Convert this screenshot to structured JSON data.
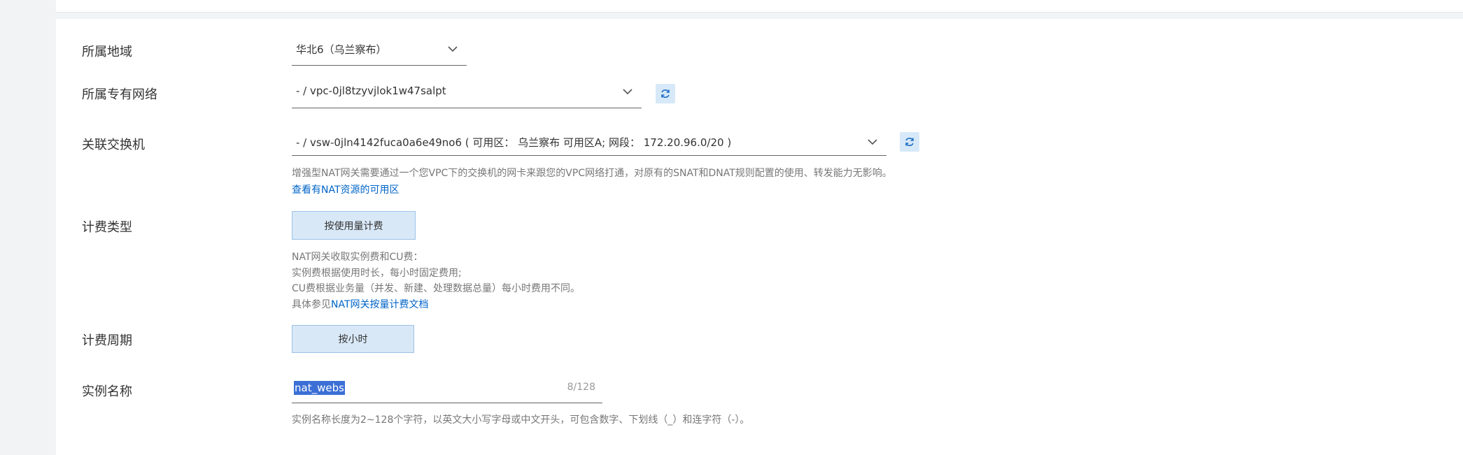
{
  "region": {
    "label": "所属地域",
    "value": "华北6（乌兰察布）"
  },
  "vpc": {
    "label": "所属专有网络",
    "value": "- / vpc-0jl8tzyvjlok1w47salpt"
  },
  "vswitch": {
    "label": "关联交换机",
    "value": "- / vsw-0jln4142fuca0a6e49no6 ( 可用区： 乌兰察布 可用区A; 网段： 172.20.96.0/20 )",
    "help": "增强型NAT网关需要通过一个您VPC下的交换机的网卡来跟您的VPC网络打通，对原有的SNAT和DNAT规则配置的使用、转发能力无影响。",
    "link": "查看有NAT资源的可用区"
  },
  "billing_type": {
    "label": "计费类型",
    "option": "按使用量计费",
    "help_lines": [
      "NAT网关收取实例费和CU费：",
      "实例费根据使用时长，每小时固定费用;",
      "CU费根据业务量（并发、新建、处理数据总量）每小时费用不同。"
    ],
    "help_prefix": "具体参见",
    "help_link": "NAT网关按量计费文档"
  },
  "billing_cycle": {
    "label": "计费周期",
    "option": "按小时"
  },
  "instance_name": {
    "label": "实例名称",
    "value": "nat_webs",
    "counter": "8/128",
    "help": "实例名称长度为2~128个字符，以英文大小写字母或中文开头，可包含数字、下划线（_）和连字符（-）。"
  }
}
